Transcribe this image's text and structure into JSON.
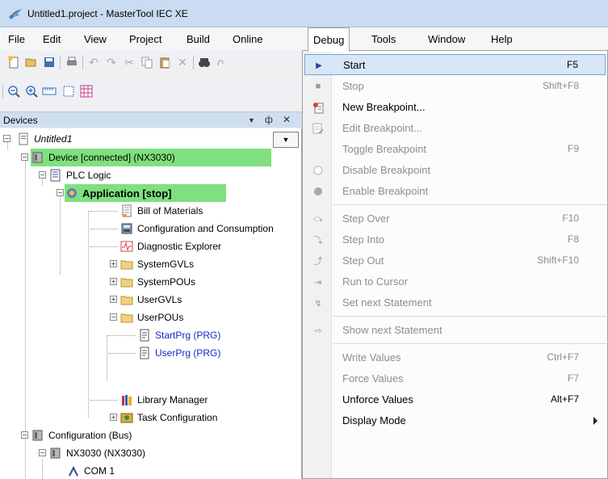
{
  "window": {
    "title": "Untitled1.project - MasterTool IEC XE"
  },
  "menubar": [
    {
      "label": "File"
    },
    {
      "label": "Edit"
    },
    {
      "label": "View"
    },
    {
      "label": "Project"
    },
    {
      "label": "Build"
    },
    {
      "label": "Online"
    },
    {
      "label": "Debug"
    },
    {
      "label": "Tools"
    },
    {
      "label": "Window"
    },
    {
      "label": "Help"
    }
  ],
  "panel": {
    "title": "Devices",
    "pin": "ф",
    "close": "✕",
    "dropdown": "▼"
  },
  "tree": [
    {
      "label": "Untitled1",
      "icon": "project-icon"
    },
    {
      "label": "Device [connected] (NX3030)",
      "icon": "device-icon"
    },
    {
      "label": "PLC Logic",
      "icon": "plc-logic-icon"
    },
    {
      "label": "Application [stop]",
      "icon": "application-gear-icon"
    },
    {
      "label": "Bill of Materials",
      "icon": "document-icon"
    },
    {
      "label": "Configuration and Consumption",
      "icon": "calculator-icon"
    },
    {
      "label": "Diagnostic Explorer",
      "icon": "diagnostic-icon"
    },
    {
      "label": "SystemGVLs",
      "icon": "folder-icon"
    },
    {
      "label": "SystemPOUs",
      "icon": "folder-icon"
    },
    {
      "label": "UserGVLs",
      "icon": "folder-icon"
    },
    {
      "label": "UserPOUs",
      "icon": "folder-icon"
    },
    {
      "label": "StartPrg (PRG)",
      "icon": "program-icon"
    },
    {
      "label": "UserPrg (PRG)",
      "icon": "program-icon"
    },
    {
      "label": "Library Manager",
      "icon": "library-books-icon"
    },
    {
      "label": "Task Configuration",
      "icon": "task-config-icon"
    },
    {
      "label": "Configuration (Bus)",
      "icon": "device-icon"
    },
    {
      "label": "NX3030 (NX3030)",
      "icon": "device-icon"
    },
    {
      "label": "COM 1",
      "icon": "com-port-icon"
    }
  ],
  "debug_menu": [
    {
      "label": "Start",
      "shortcut": "F5",
      "icon": "play-icon",
      "enabled": true
    },
    {
      "label": "Stop",
      "shortcut": "Shift+F8",
      "icon": "stop-icon",
      "enabled": false
    },
    {
      "label": "New Breakpoint...",
      "shortcut": "",
      "icon": "new-breakpoint-icon",
      "enabled": true
    },
    {
      "label": "Edit Breakpoint...",
      "shortcut": "",
      "icon": "edit-breakpoint-icon",
      "enabled": false
    },
    {
      "label": "Toggle Breakpoint",
      "shortcut": "F9",
      "icon": "",
      "enabled": false
    },
    {
      "label": "Disable Breakpoint",
      "shortcut": "",
      "icon": "disable-breakpoint-icon",
      "enabled": false
    },
    {
      "label": "Enable Breakpoint",
      "shortcut": "",
      "icon": "enable-breakpoint-icon",
      "enabled": false
    },
    {
      "label": "Step Over",
      "shortcut": "F10",
      "icon": "step-over-icon",
      "enabled": false
    },
    {
      "label": "Step Into",
      "shortcut": "F8",
      "icon": "step-into-icon",
      "enabled": false
    },
    {
      "label": "Step Out",
      "shortcut": "Shift+F10",
      "icon": "step-out-icon",
      "enabled": false
    },
    {
      "label": "Run to Cursor",
      "shortcut": "",
      "icon": "run-to-cursor-icon",
      "enabled": false
    },
    {
      "label": "Set next Statement",
      "shortcut": "",
      "icon": "set-next-statement-icon",
      "enabled": false
    },
    {
      "label": "Show next Statement",
      "shortcut": "",
      "icon": "show-next-statement-icon",
      "enabled": false
    },
    {
      "label": "Write Values",
      "shortcut": "Ctrl+F7",
      "icon": "",
      "enabled": false
    },
    {
      "label": "Force Values",
      "shortcut": "F7",
      "icon": "",
      "enabled": false
    },
    {
      "label": "Unforce Values",
      "shortcut": "Alt+F7",
      "icon": "",
      "enabled": true
    },
    {
      "label": "Display Mode",
      "shortcut": "",
      "icon": "",
      "enabled": true,
      "submenu": true
    }
  ],
  "colors": {
    "highlight_green": "#7fe07f",
    "menu_selected": "#d7e7f8",
    "link_blue": "#1a27c9",
    "titlebar": "#c9dcf1"
  }
}
